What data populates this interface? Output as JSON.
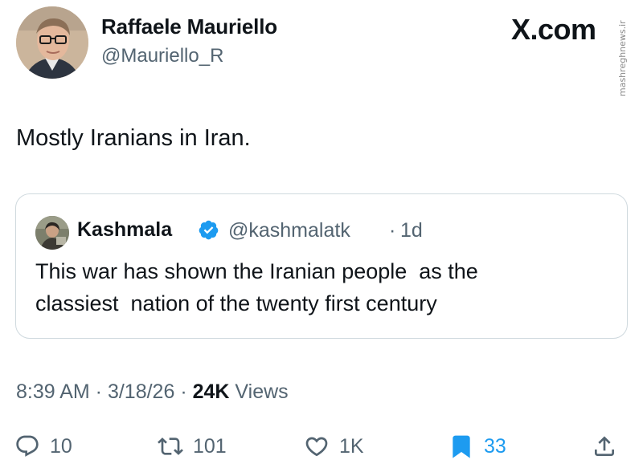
{
  "author": {
    "name": "Raffaele Mauriello",
    "handle": "@Mauriello_R",
    "avatar_icon": "person-photo-avatar"
  },
  "brand": {
    "logo_text": "X.com",
    "watermark_text": "mashreghnews.ir"
  },
  "post": {
    "text": "Mostly Iranians in Iran."
  },
  "quoted_post": {
    "name": "Kashmala",
    "verified_icon": "verified-badge-icon",
    "verified_color": "#1d9bf0",
    "handle": "@kashmalatk",
    "separator": "·",
    "time": "1d",
    "text": "This war has shown the Iranian people  as the\nclassiest  nation of the twenty first century"
  },
  "meta": {
    "time": "8:39 AM",
    "dot1": " · ",
    "date": "3/18/26",
    "dot2": " · ",
    "views_count": "24K",
    "views_label": " Views"
  },
  "actions": {
    "reply": {
      "icon": "reply-icon",
      "count": "10"
    },
    "repost": {
      "icon": "repost-icon",
      "count": "101"
    },
    "like": {
      "icon": "heart-icon",
      "count": "1K"
    },
    "bookmark": {
      "icon": "bookmark-icon",
      "count": "33",
      "active_color": "#1d9bf0"
    },
    "share": {
      "icon": "share-icon"
    }
  }
}
